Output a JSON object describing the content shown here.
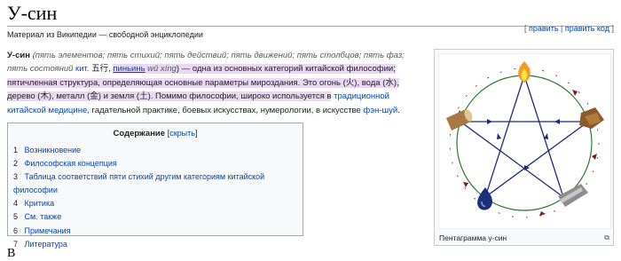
{
  "article": {
    "title": "У-син",
    "tagline": "Материал из Википедии — свободной энциклопедии",
    "edit_link": "править",
    "edit_code_link": "править код",
    "next_heading": "В"
  },
  "intro": {
    "term": "У-син",
    "gloss": "(пять элементов; пять стихий; пять действий; пять движений; пять столбцов; пять фаз; пять состояний",
    "kit_link": "кит.",
    "hanzi": "五行",
    "pinyin_link": "пиньинь",
    "pinyin": "wǔ xíng",
    "text1": ") — одна из основных категорий китайской философии; пятичленная структура, определяющая основные параметры мироздания. Это огонь (火), вода (水), дерево (木), металл (金) и земля (土). Помимо философии, широко используется в",
    "tcm_link": "традиционной китайской медицине",
    "text2": ", гадательной практике, боевых искусствах, нумерологии, в искусстве",
    "fengshui_link": "фэн-шуй",
    "text3": "."
  },
  "toc": {
    "title": "Содержание",
    "toggle": "скрыть",
    "items": [
      {
        "num": "1",
        "label": "Возникновение"
      },
      {
        "num": "2",
        "label": "Философская концепция"
      },
      {
        "num": "3",
        "label": "Таблица соответствий пяти стихий другим категориям китайской философии"
      },
      {
        "num": "4",
        "label": "Критика"
      },
      {
        "num": "5",
        "label": "См. также"
      },
      {
        "num": "6",
        "label": "Примечания"
      },
      {
        "num": "7",
        "label": "Литература"
      }
    ]
  },
  "figure": {
    "caption": "Пентаграмма у-син",
    "magnify_icon": "magnify-icon",
    "colors": {
      "generating": "#2a7a2a",
      "overcoming": "#1f2a7a",
      "outer_arrows": "#7a1f1f"
    }
  }
}
